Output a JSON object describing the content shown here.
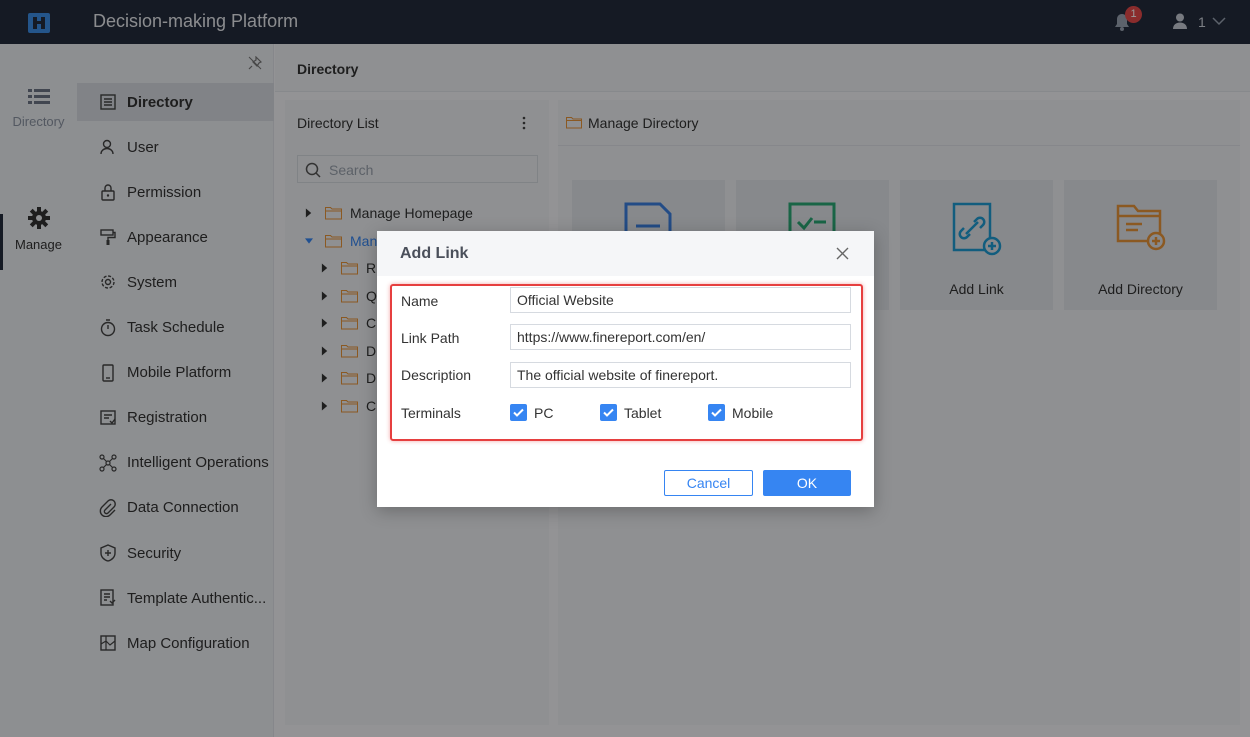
{
  "app": {
    "title": "Decision-making Platform"
  },
  "header": {
    "notification_count": "1",
    "user_name": "1"
  },
  "rail": {
    "directory_label": "Directory",
    "manage_label": "Manage"
  },
  "nav": {
    "items": [
      {
        "label": "Directory",
        "icon": "directory-icon"
      },
      {
        "label": "User",
        "icon": "user-icon"
      },
      {
        "label": "Permission",
        "icon": "lock-icon"
      },
      {
        "label": "Appearance",
        "icon": "paint-roller-icon"
      },
      {
        "label": "System",
        "icon": "gear-icon"
      },
      {
        "label": "Task Schedule",
        "icon": "stopwatch-icon"
      },
      {
        "label": "Mobile Platform",
        "icon": "mobile-icon"
      },
      {
        "label": "Registration",
        "icon": "registration-icon"
      },
      {
        "label": "Intelligent Operations",
        "icon": "network-icon"
      },
      {
        "label": "Data Connection",
        "icon": "paperclip-icon"
      },
      {
        "label": "Security",
        "icon": "shield-icon"
      },
      {
        "label": "Template Authentic...",
        "icon": "template-icon"
      },
      {
        "label": "Map Configuration",
        "icon": "map-icon"
      }
    ]
  },
  "main": {
    "title": "Directory"
  },
  "directory_list": {
    "title": "Directory List",
    "search_placeholder": "Search",
    "tree": [
      {
        "label": "Manage Homepage",
        "expanded": false
      },
      {
        "label": "Mana",
        "expanded": true
      },
      {
        "label": "R",
        "expanded": false
      },
      {
        "label": "Q",
        "expanded": false
      },
      {
        "label": "C",
        "expanded": false
      },
      {
        "label": "D",
        "expanded": false
      },
      {
        "label": "D",
        "expanded": false
      },
      {
        "label": "C",
        "expanded": false
      }
    ]
  },
  "manage_directory": {
    "title": "Manage Directory",
    "cards": [
      {
        "label": ""
      },
      {
        "label": ""
      },
      {
        "label": "Add Link"
      },
      {
        "label": "Add Directory"
      }
    ]
  },
  "dialog": {
    "title": "Add Link",
    "fields": {
      "name": {
        "label": "Name",
        "value": "Official Website"
      },
      "link_path": {
        "label": "Link Path",
        "value": "https://www.finereport.com/en/"
      },
      "description": {
        "label": "Description",
        "value": "The official website of finereport."
      },
      "terminals": {
        "label": "Terminals"
      }
    },
    "terminals": [
      {
        "label": "PC",
        "checked": true
      },
      {
        "label": "Tablet",
        "checked": true
      },
      {
        "label": "Mobile",
        "checked": true
      }
    ],
    "cancel_label": "Cancel",
    "ok_label": "OK"
  },
  "colors": {
    "accent": "#3685f2",
    "topbar": "#232c3c",
    "highlight": "#e63f3f",
    "folder": "#e8943a"
  }
}
